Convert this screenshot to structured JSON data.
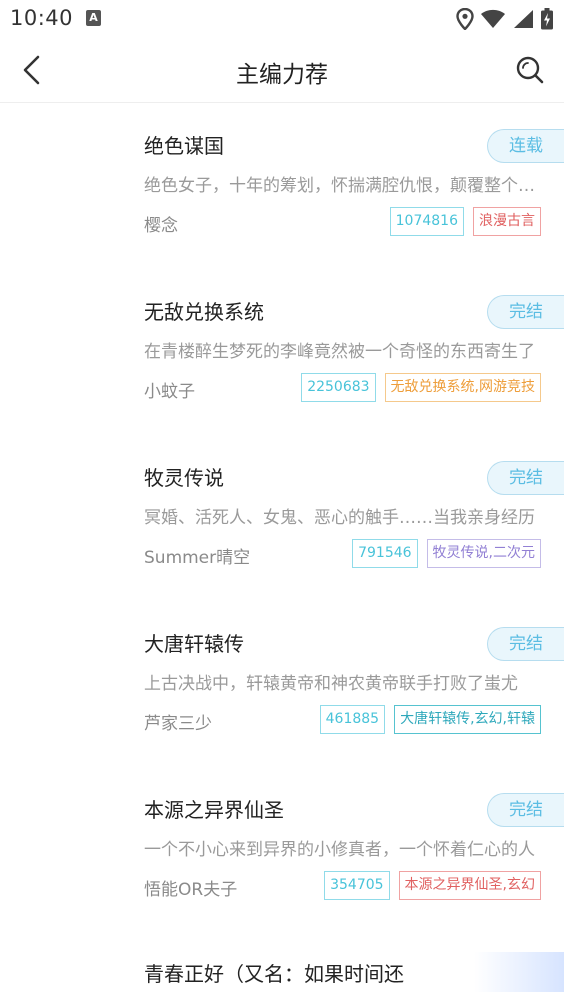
{
  "status_bar": {
    "time": "10:40",
    "app_icon": "A"
  },
  "header": {
    "title": "主编力荐"
  },
  "books": [
    {
      "title": "绝色谋国",
      "status": "连载",
      "description": "绝色女子，十年的筹划，怀揣满腔仇恨，颠覆整个天下",
      "author": "樱念",
      "count": "1074816",
      "genre": "浪漫古言",
      "genre_color": "red"
    },
    {
      "title": "无敌兑换系统",
      "status": "完结",
      "description": "在青楼醉生梦死的李峰竟然被一个奇怪的东西寄生了",
      "author": "小蚊子",
      "count": "2250683",
      "genre": "无敌兑换系统,网游竞技",
      "genre_color": "orange"
    },
    {
      "title": "牧灵传说",
      "status": "完结",
      "description": "冥婚、活死人、女鬼、恶心的触手……当我亲身经历",
      "author": "Summer晴空",
      "count": "791546",
      "genre": "牧灵传说,二次元",
      "genre_color": "purple"
    },
    {
      "title": "大唐轩辕传",
      "status": "完结",
      "description": "上古决战中，轩辕黄帝和神农黄帝联手打败了蚩尤",
      "author": "芦家三少",
      "count": "461885",
      "genre": "大唐轩辕传,玄幻,轩辕",
      "genre_color": "teal"
    },
    {
      "title": "本源之异界仙圣",
      "status": "完结",
      "description": "一个不小心来到异界的小修真者，一个怀着仁心的人",
      "author": "悟能OR夫子",
      "count": "354705",
      "genre": "本源之异界仙圣,玄幻",
      "genre_color": "red"
    }
  ],
  "partial_item": {
    "title": "青春正好（又名：如果时间还"
  }
}
